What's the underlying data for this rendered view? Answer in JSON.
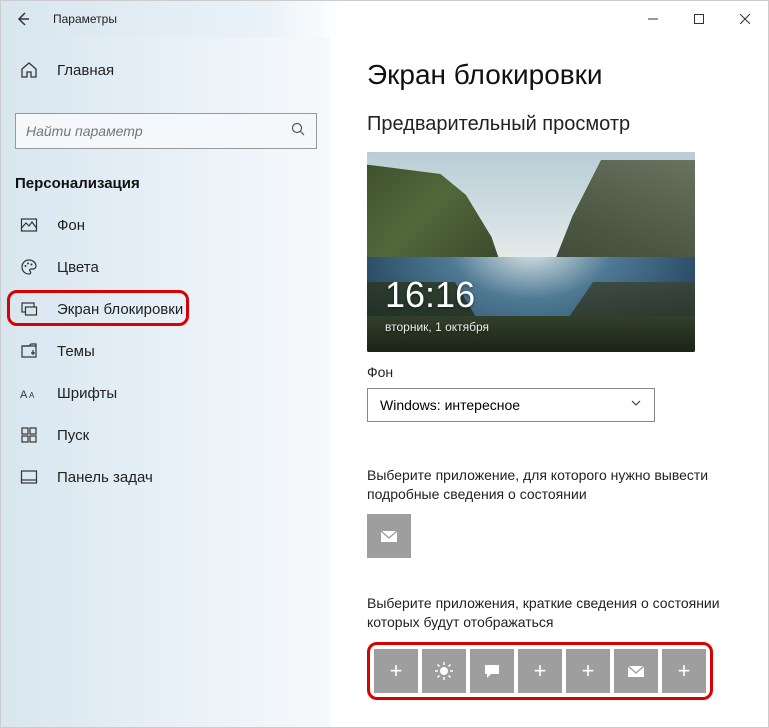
{
  "window": {
    "title": "Параметры"
  },
  "home": {
    "label": "Главная"
  },
  "search": {
    "placeholder": "Найти параметр"
  },
  "section": "Персонализация",
  "nav": [
    {
      "label": "Фон"
    },
    {
      "label": "Цвета"
    },
    {
      "label": "Экран блокировки"
    },
    {
      "label": "Темы"
    },
    {
      "label": "Шрифты"
    },
    {
      "label": "Пуск"
    },
    {
      "label": "Панель задач"
    }
  ],
  "main": {
    "title": "Экран блокировки",
    "preview_heading": "Предварительный просмотр",
    "preview_time": "16:16",
    "preview_date": "вторник, 1 октября",
    "background_label": "Фон",
    "background_value": "Windows: интересное",
    "detail_app_desc": "Выберите приложение, для которого нужно вывести подробные сведения о состоянии",
    "quick_apps_desc": "Выберите приложения, краткие сведения о состоянии которых будут отображаться",
    "tile_icons": [
      "plus",
      "weather",
      "chat",
      "plus",
      "plus",
      "mail",
      "plus"
    ]
  }
}
